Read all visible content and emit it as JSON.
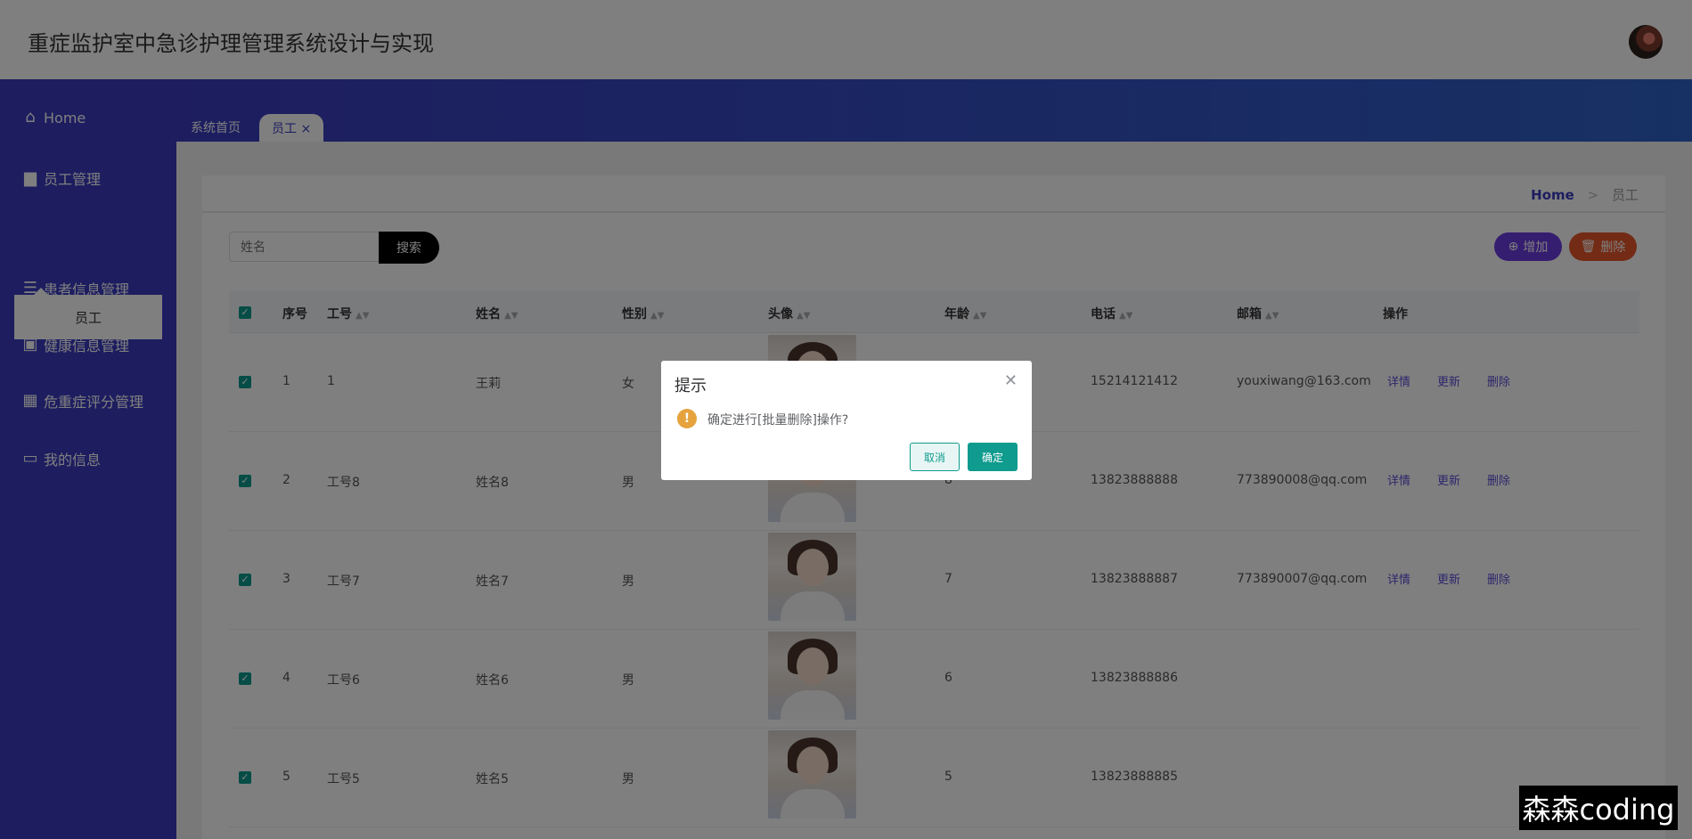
{
  "app": {
    "title": "重症监护室中急诊护理管理系统设计与实现"
  },
  "sidebar": {
    "items": [
      {
        "label": "Home"
      },
      {
        "label": "员工管理"
      },
      {
        "label": "患者信息管理"
      },
      {
        "label": "健康信息管理"
      },
      {
        "label": "危重症评分管理"
      },
      {
        "label": "我的信息"
      }
    ],
    "submenu_label": "员工"
  },
  "tabs": [
    {
      "label": "系统首页"
    },
    {
      "label": "员工 ×"
    }
  ],
  "breadcrumb": {
    "home": "Home",
    "sep": ">",
    "current": "员工"
  },
  "search": {
    "placeholder": "姓名",
    "button": "搜索"
  },
  "toolbar": {
    "add": "增加",
    "delete": "删除"
  },
  "table": {
    "headers": [
      "序号",
      "工号",
      "姓名",
      "性别",
      "头像",
      "年龄",
      "电话",
      "邮箱",
      "操作"
    ],
    "rows": [
      {
        "idx": "1",
        "no": "1",
        "name": "王莉",
        "gender": "女",
        "age": "",
        "phone": "15214121412",
        "email": "youxiwang@163.com"
      },
      {
        "idx": "2",
        "no": "工号8",
        "name": "姓名8",
        "gender": "男",
        "age": "8",
        "phone": "13823888888",
        "email": "773890008@qq.com"
      },
      {
        "idx": "3",
        "no": "工号7",
        "name": "姓名7",
        "gender": "男",
        "age": "7",
        "phone": "13823888887",
        "email": "773890007@qq.com"
      },
      {
        "idx": "4",
        "no": "工号6",
        "name": "姓名6",
        "gender": "男",
        "age": "6",
        "phone": "13823888886",
        "email": ""
      },
      {
        "idx": "5",
        "no": "工号5",
        "name": "姓名5",
        "gender": "男",
        "age": "5",
        "phone": "13823888885",
        "email": ""
      }
    ],
    "actions": {
      "detail": "详情",
      "update": "更新",
      "delete": "删除"
    }
  },
  "dialog": {
    "title": "提示",
    "message": "确定进行[批量删除]操作?",
    "cancel": "取消",
    "ok": "确定"
  },
  "watermark": "森森coding",
  "colors": {
    "sidebar": "#3b3bc0",
    "accent": "#0f9b8e",
    "add": "#6b3be0",
    "delete": "#e8562a"
  }
}
